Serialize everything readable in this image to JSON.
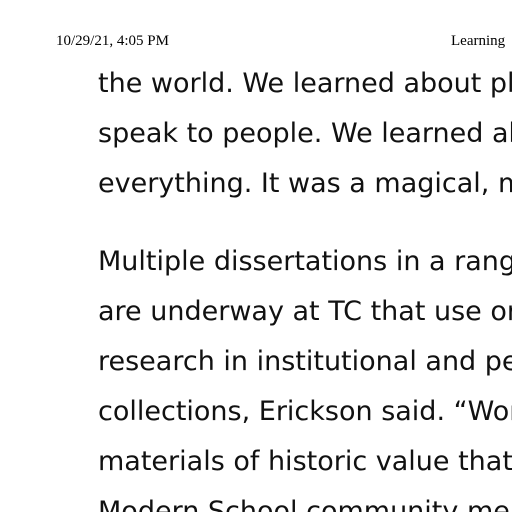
{
  "print_header": {
    "datetime": "10/29/21, 4:05 PM",
    "title": "Learning"
  },
  "article": {
    "paragraphs": [
      {
        "lines": [
          "the world. We learned about pla",
          "speak to people. We learned ab",
          "everything. It was a magical, ma"
        ]
      },
      {
        "lines": [
          "Multiple dissertations in a range",
          "are underway at TC that use ora",
          "research in institutional and per",
          "collections, Erickson said. “Work",
          "materials of historic value that a",
          "Modern School community mem"
        ]
      }
    ]
  }
}
